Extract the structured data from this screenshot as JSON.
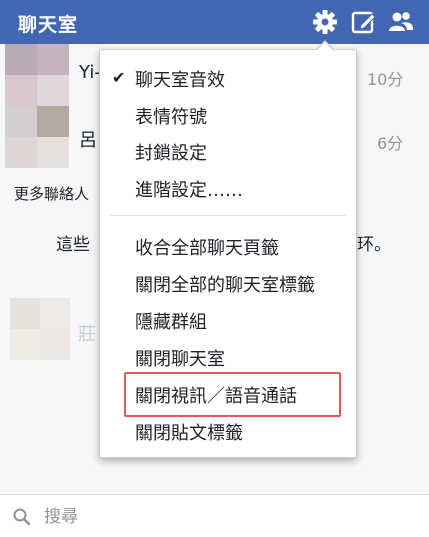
{
  "header": {
    "title": "聊天室",
    "color": "#4267b2"
  },
  "contacts": [
    {
      "name": "Yi-",
      "time": "10分"
    },
    {
      "name": "呂",
      "time": "6分"
    }
  ],
  "more_contacts_label": "更多聯絡人",
  "note": {
    "start": "這些",
    "end": "环。"
  },
  "faded_contact": "莊",
  "menu": {
    "items": [
      {
        "label": "聊天室音效",
        "checked": true
      },
      {
        "label": "表情符號"
      },
      {
        "label": "封鎖設定"
      },
      {
        "label": "進階設定……"
      },
      {
        "label": "收合全部聊天頁籤"
      },
      {
        "label": "關閉全部的聊天室標籤"
      },
      {
        "label": "隱藏群組"
      },
      {
        "label": "關閉聊天室"
      },
      {
        "label": "關閉視訊／語音通話",
        "highlighted": true
      },
      {
        "label": "關閉貼文標籤"
      }
    ],
    "check_glyph": "✔"
  },
  "search": {
    "placeholder": "搜尋",
    "value": ""
  },
  "icons": [
    "gear-icon",
    "compose-icon",
    "add-friends-icon",
    "search-icon"
  ],
  "colors": {
    "highlight": "#e4575a",
    "muted": "#90949c"
  }
}
